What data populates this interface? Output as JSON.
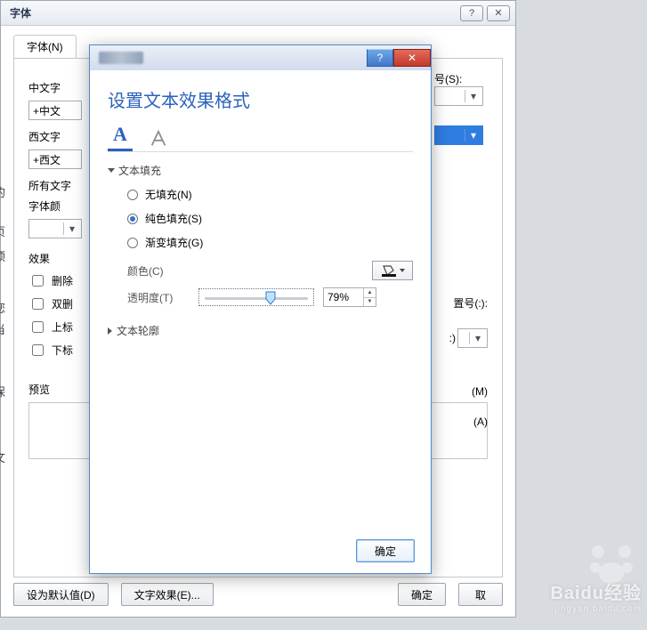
{
  "fontDialog": {
    "title": "字体",
    "helpBtn": "?",
    "closeBtn": "✕",
    "tab": "字体(N)",
    "labels": {
      "chineseFont": "中文字",
      "chineseFontValue": "+中文",
      "westernFont": "西文字",
      "westernFontValue": "+西文",
      "allText": "所有文字",
      "fontColor": "字体颜",
      "effects": "效果",
      "strike": "删除",
      "dblStrike": "双删",
      "superscript": "上标",
      "subscript": "下标",
      "preview": "预览",
      "numberStyle": "号(S):",
      "numberColon": "置号(:):",
      "rightCombo": ":)",
      "rightLetterM": "(M)",
      "rightLetterA": "(A)"
    },
    "footer": {
      "setDefault": "设为默认值(D)",
      "textEffects": "文字效果(E)...",
      "ok": "确定",
      "cancel": "取"
    }
  },
  "fxDialog": {
    "helpBtn": "?",
    "closeBtn": "✕",
    "heading": "设置文本效果格式",
    "tabs": {
      "a": "A"
    },
    "textFill": {
      "header": "文本填充",
      "noFill": "无填充(N)",
      "solidFill": "纯色填充(S)",
      "gradientFill": "渐变填充(G)",
      "color": "颜色(C)",
      "transparency": "透明度(T)",
      "transparencyValue": "79%"
    },
    "textOutline": {
      "header": "文本轮廓"
    },
    "ok": "确定"
  },
  "watermark": {
    "brand": "Baidu经验",
    "url": "jingyan.baidu.com"
  }
}
